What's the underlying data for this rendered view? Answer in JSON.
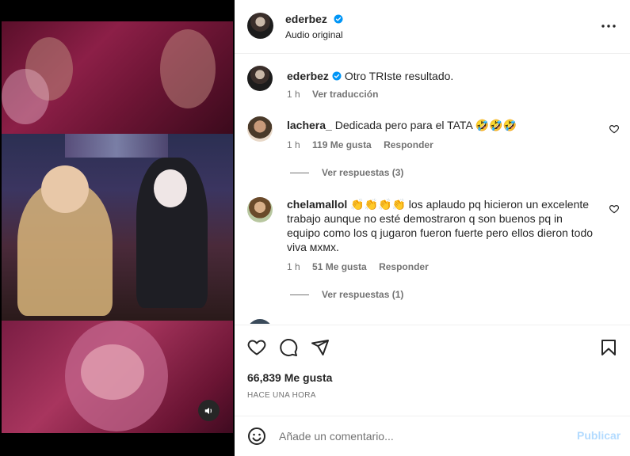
{
  "header": {
    "username": "ederbez",
    "subtitle": "Audio original",
    "more_icon": "more-horizontal-icon"
  },
  "caption": {
    "username": "ederbez",
    "text": "Otro TRIste resultado.",
    "time": "1 h",
    "translate": "Ver traducción"
  },
  "comments": [
    {
      "username": "lachera_",
      "text": "Dedicada pero para el TATA",
      "emoji": "🤣🤣🤣",
      "time": "1 h",
      "likes": "119 Me gusta",
      "reply": "Responder",
      "view_replies": "Ver respuestas (3)"
    },
    {
      "username": "chelamallol",
      "emoji": "👏👏👏👏",
      "text": "los aplaudo pq hicieron un excelente trabajo aunque no esté demostraron q son buenos pq in equipo como los q jugaron fueron fuerte pero ellos dieron todo viva ᴍxᴍx.",
      "time": "1 h",
      "likes": "51 Me gusta",
      "reply": "Responder",
      "view_replies": "Ver respuestas (1)"
    }
  ],
  "actions": {
    "likes": "66,839 Me gusta",
    "time_ago": "HACE UNA HORA"
  },
  "composer": {
    "placeholder": "Añade un comentario...",
    "publish": "Publicar"
  },
  "colors": {
    "verified": "#0095f6",
    "publish_disabled": "#b3dbff",
    "muted": "#737373"
  }
}
